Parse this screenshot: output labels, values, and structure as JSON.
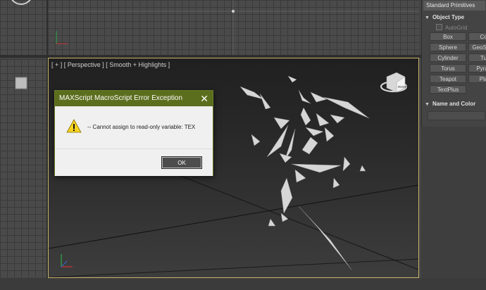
{
  "viewport": {
    "label": "[ + ] [ Perspective ] [ Smooth + Highlights ]",
    "viewcube_face": "RIGHT"
  },
  "command_panel": {
    "category": "Standard Primitives",
    "object_type_header": "Object Type",
    "autogrid_label": "AutoGrid",
    "primitives": [
      "Box",
      "Cone",
      "Sphere",
      "GeoSphere",
      "Cylinder",
      "Tube",
      "Torus",
      "Pyramid",
      "Teapot",
      "Plane",
      "TextPlus"
    ],
    "name_color_header": "Name and Color",
    "name_value": ""
  },
  "dialog": {
    "title": "MAXScript MacroScript Error Exception",
    "close_symbol": "✕",
    "message": "-- Cannot assign to read-only variable: TEX",
    "ok_label": "OK",
    "titlebar_color": "#5b6e1d",
    "icon": "warning-icon"
  }
}
